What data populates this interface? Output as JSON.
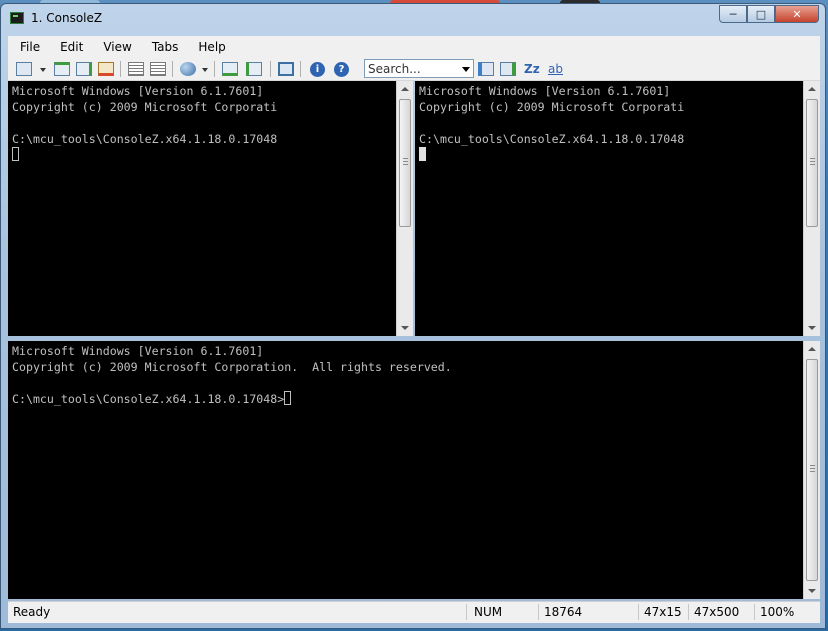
{
  "window": {
    "title": "1. ConsoleZ",
    "minimize_label": "─",
    "maximize_label": "□",
    "close_label": "✕"
  },
  "menu": {
    "items": [
      "File",
      "Edit",
      "View",
      "Tabs",
      "Help"
    ]
  },
  "toolbar": {
    "search_placeholder": "Search...",
    "icons": [
      "new-tab-icon",
      "new-tab-dropdown-icon",
      "split-horizontal-icon",
      "split-vertical-icon",
      "clone-tab-icon",
      "close-view-icon",
      "copy-icon",
      "paste-icon",
      "group-icon",
      "group-dropdown-icon",
      "select-all-icon",
      "merge-icon",
      "fullscreen-icon",
      "info-icon",
      "help-icon",
      "search-prev-icon",
      "search-next-icon",
      "match-case-icon",
      "whole-word-icon"
    ],
    "match_case_label": "Zz",
    "whole_word_label": "ab"
  },
  "panes": {
    "top_left": {
      "line1": "Microsoft Windows [Version 6.1.7601]",
      "line2": "Copyright (c) 2009 Microsoft Corporati",
      "line3": "",
      "line4": "C:\\mcu_tools\\ConsoleZ.x64.1.18.0.17048"
    },
    "top_right": {
      "line1": "Microsoft Windows [Version 6.1.7601]",
      "line2": "Copyright (c) 2009 Microsoft Corporati",
      "line3": "",
      "line4": "C:\\mcu_tools\\ConsoleZ.x64.1.18.0.17048"
    },
    "bottom": {
      "line1": "Microsoft Windows [Version 6.1.7601]",
      "line2": "Copyright (c) 2009 Microsoft Corporation.  All rights reserved.",
      "line3": "",
      "line4": "C:\\mcu_tools\\ConsoleZ.x64.1.18.0.17048>"
    }
  },
  "status": {
    "message": "Ready",
    "num_lock": "NUM",
    "pid": "18764",
    "console_size": "47x15",
    "buffer_size": "47x500",
    "zoom": "100%"
  },
  "colors": {
    "console_bg": "#000000",
    "console_fg": "#c0c0c0",
    "window_frame": "#a9c3de",
    "close_button": "#c4422c"
  }
}
